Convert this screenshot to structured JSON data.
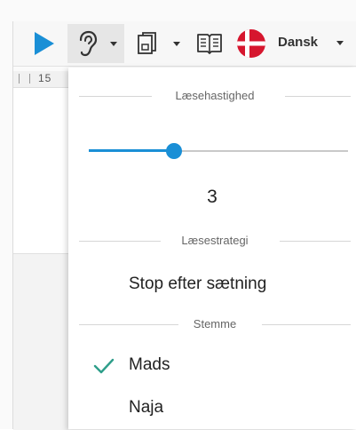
{
  "toolbar": {
    "icons": {
      "play": "play-icon",
      "ear": "ear-icon",
      "document": "document-icon",
      "book": "book-icon",
      "flag": "denmark-flag-icon"
    },
    "language_label": "Dansk",
    "accent_color": "#1a8fd6"
  },
  "ruler": {
    "number": "15"
  },
  "panel": {
    "speed_section": {
      "heading": "Læsehastighed",
      "slider_value_fraction": 0.33,
      "value": "3"
    },
    "strategy_section": {
      "heading": "Læsestrategi",
      "selected": "Stop efter sætning"
    },
    "voice_section": {
      "heading": "Stemme",
      "options": [
        {
          "label": "Mads",
          "checked": true
        },
        {
          "label": "Naja",
          "checked": false
        }
      ],
      "check_color": "#2e9e8a"
    }
  }
}
